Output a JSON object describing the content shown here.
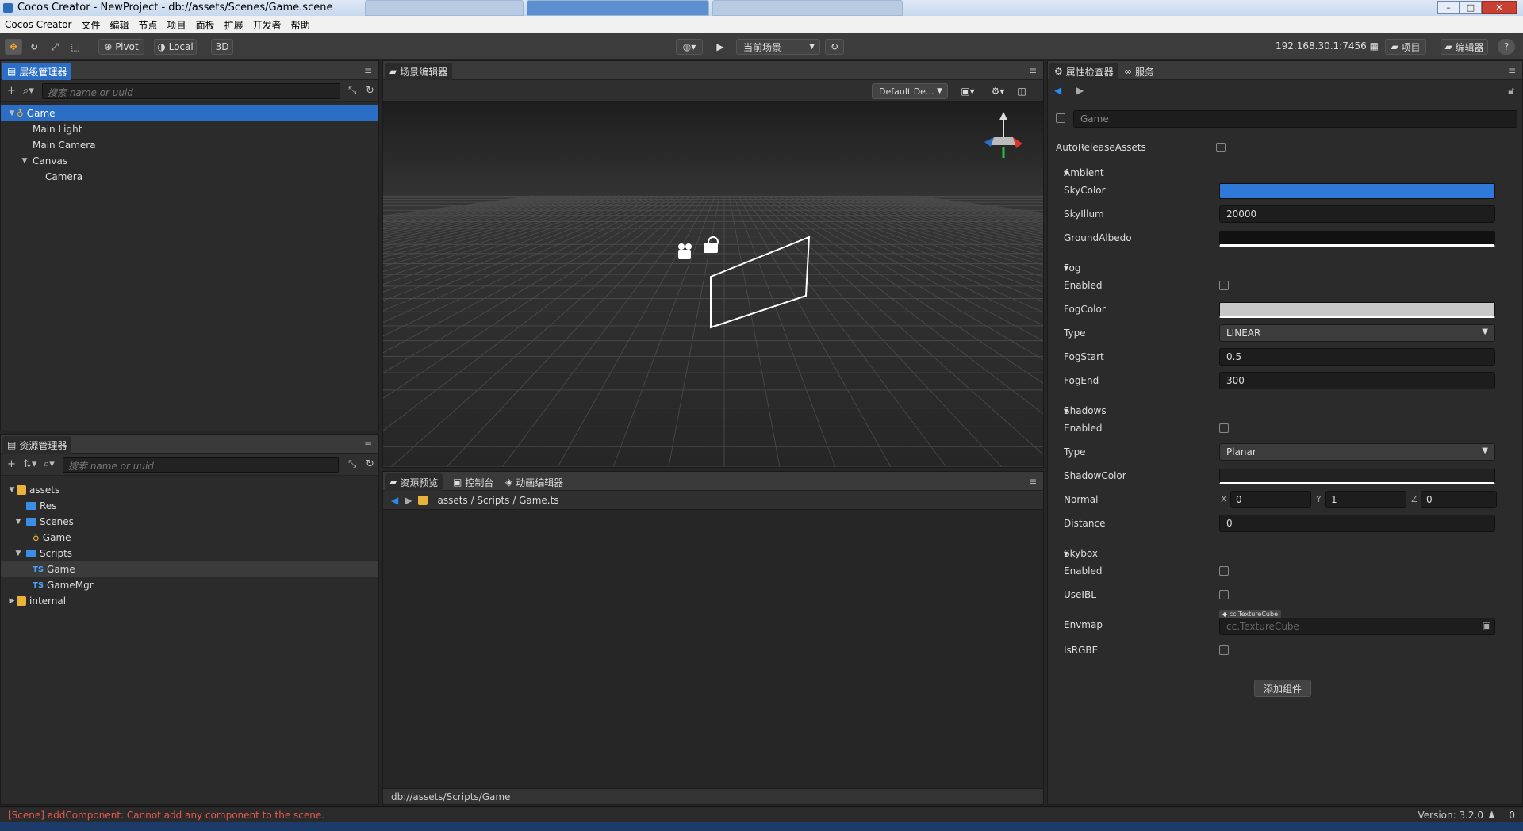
{
  "window": {
    "title": "Cocos Creator - NewProject - db://assets/Scenes/Game.scene"
  },
  "menubar": {
    "items": [
      "Cocos Creator",
      "文件",
      "编辑",
      "节点",
      "项目",
      "面板",
      "扩展",
      "开发者",
      "帮助"
    ]
  },
  "toolbar": {
    "pivot_label": "Pivot",
    "local_label": "Local",
    "mode_3d_label": "3D",
    "scene_select": "当前场景",
    "address": "192.168.30.1:7456",
    "project_label": "项目",
    "editor_label": "编辑器",
    "help_label": "?"
  },
  "hierarchy": {
    "tab": "层级管理器",
    "search_placeholder": "搜索 name or uuid",
    "nodes": [
      {
        "label": "Game"
      },
      {
        "label": "Main Light"
      },
      {
        "label": "Main Camera"
      },
      {
        "label": "Canvas"
      },
      {
        "label": "Camera"
      }
    ]
  },
  "assets": {
    "tab": "资源管理器",
    "search_placeholder": "搜索 name or uuid",
    "items": [
      {
        "label": "assets"
      },
      {
        "label": "Res"
      },
      {
        "label": "Scenes"
      },
      {
        "label": "Game"
      },
      {
        "label": "Scripts"
      },
      {
        "label": "Game"
      },
      {
        "label": "GameMgr"
      },
      {
        "label": "internal"
      }
    ],
    "ts_badge": "TS"
  },
  "scene": {
    "tab": "场景编辑器",
    "camera_select": "Default De..."
  },
  "bottom": {
    "tabs": [
      "资源预览",
      "控制台",
      "动画编辑器"
    ],
    "path": {
      "a": "assets",
      "b": "Scripts",
      "c": "Game.ts"
    },
    "footer_path": "db://assets/Scripts/Game"
  },
  "inspector": {
    "tabs": [
      "属性检查器",
      "服务"
    ],
    "node_name": "Game",
    "auto_release_label": "AutoReleaseAssets",
    "ambient": {
      "title": "Ambient",
      "sky_color_label": "SkyColor",
      "sky_illum_label": "SkyIllum",
      "sky_illum_value": "20000",
      "ground_albedo_label": "GroundAlbedo"
    },
    "fog": {
      "title": "Fog",
      "enabled_label": "Enabled",
      "fog_color_label": "FogColor",
      "type_label": "Type",
      "type_value": "LINEAR",
      "fog_start_label": "FogStart",
      "fog_start_value": "0.5",
      "fog_end_label": "FogEnd",
      "fog_end_value": "300"
    },
    "shadows": {
      "title": "Shadows",
      "enabled_label": "Enabled",
      "type_label": "Type",
      "type_value": "Planar",
      "shadow_color_label": "ShadowColor",
      "normal_label": "Normal",
      "normal_x_label": "X",
      "normal_x": "0",
      "normal_y_label": "Y",
      "normal_y": "1",
      "normal_z_label": "Z",
      "normal_z": "0",
      "distance_label": "Distance",
      "distance_value": "0"
    },
    "skybox": {
      "title": "Skybox",
      "enabled_label": "Enabled",
      "use_ibl_label": "UseIBL",
      "envmap_label": "Envmap",
      "envmap_badge": "cc.TextureCube",
      "envmap_placeholder": "cc.TextureCube",
      "is_rgbe_label": "IsRGBE"
    },
    "add_component_label": "添加组件"
  },
  "status": {
    "message": "[Scene] addComponent: Cannot add any component to the scene.",
    "version": "Version: 3.2.0",
    "notifications": "0"
  },
  "colors": {
    "accent": "#2a6fc5",
    "sky_color": "#2f7ad9",
    "fog_color": "#c8c8c8",
    "error_text": "#e55a4f"
  }
}
